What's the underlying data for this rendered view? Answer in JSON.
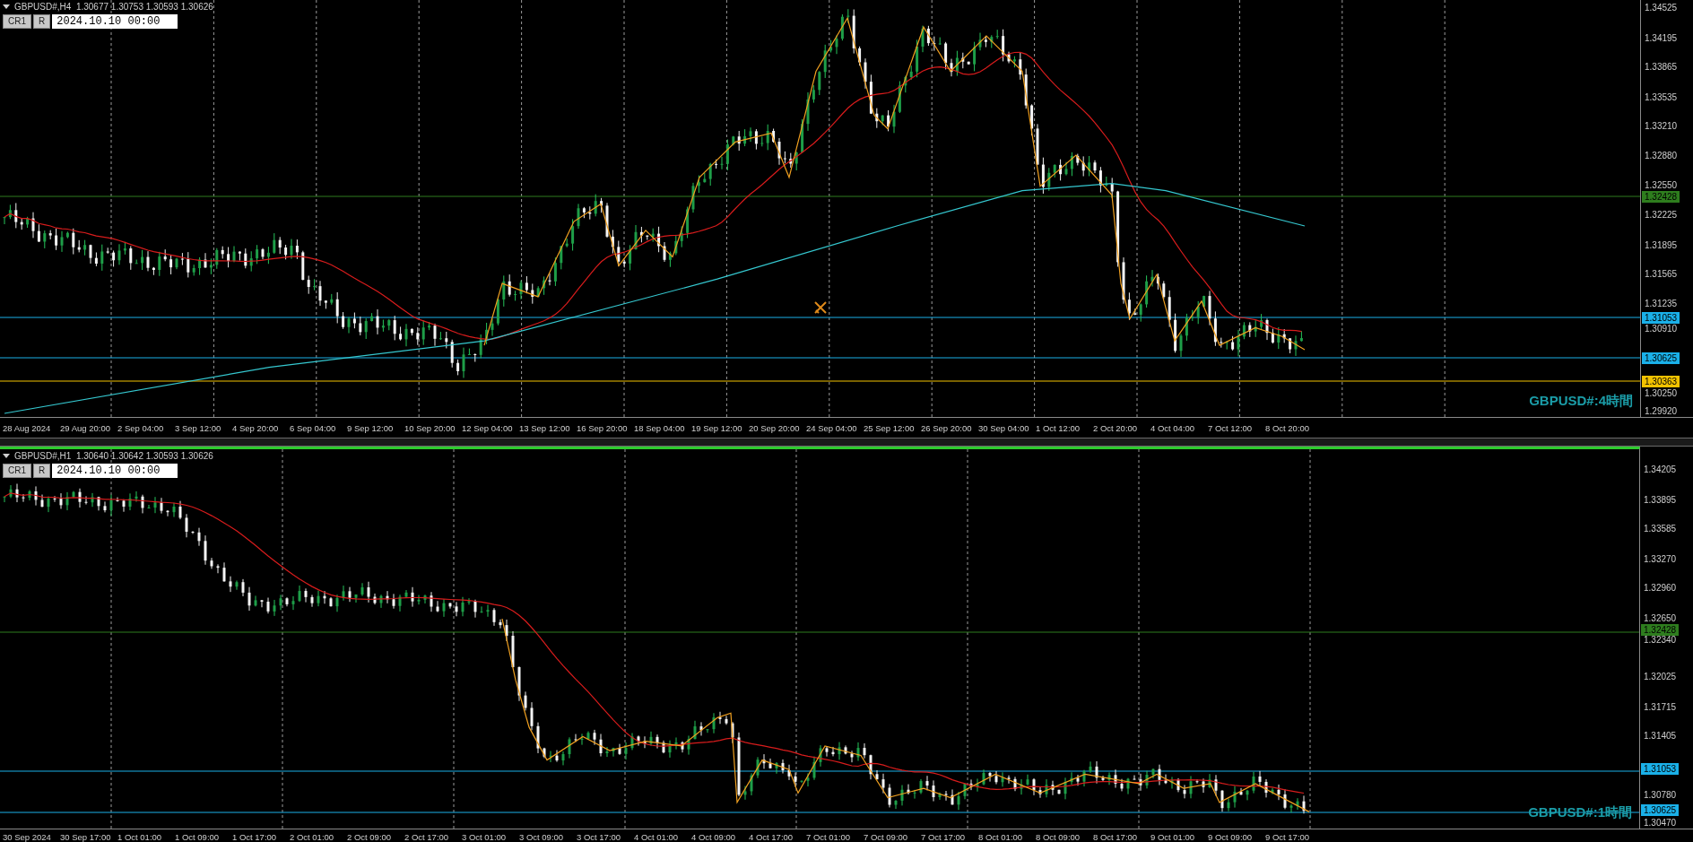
{
  "charts": [
    {
      "header": {
        "title": "GBPUSD#,H4  1.30677 1.30753 1.30593 1.30626"
      },
      "buttons": [
        "CR1",
        "R"
      ],
      "date_field": "2024.10.10 00:00",
      "price_ticks": [
        "1.34525",
        "1.34195",
        "1.33865",
        "1.33535",
        "1.33210",
        "1.32880",
        "1.32550",
        "1.32225",
        "1.31895",
        "1.31565",
        "1.31235",
        "1.30910",
        "1.30250",
        "1.29920"
      ],
      "levels": [
        {
          "price": "1.32428",
          "color": "#2e7d1e"
        },
        {
          "price": "1.31053",
          "color": "#1ab0e8"
        },
        {
          "price": "1.30625",
          "color": "#1ab0e8"
        },
        {
          "price": "1.30363",
          "color": "#f2c200"
        }
      ],
      "time_labels": [
        "28 Aug 2024",
        "29 Aug 20:00",
        "2 Sep 04:00",
        "3 Sep 12:00",
        "4 Sep 20:00",
        "6 Sep 04:00",
        "9 Sep 12:00",
        "10 Sep 20:00",
        "12 Sep 04:00",
        "13 Sep 12:00",
        "16 Sep 20:00",
        "18 Sep 04:00",
        "19 Sep 12:00",
        "20 Sep 20:00",
        "24 Sep 04:00",
        "25 Sep 12:00",
        "26 Sep 20:00",
        "30 Sep 04:00",
        "1 Oct 12:00",
        "2 Oct 20:00",
        "4 Oct 04:00",
        "7 Oct 12:00",
        "8 Oct 20:00"
      ],
      "timeframe_label": "GBPUSD#:4時間"
    },
    {
      "header": {
        "title": "GBPUSD#,H1  1.30640 1.30642 1.30593 1.30626"
      },
      "buttons": [
        "CR1",
        "R"
      ],
      "date_field": "2024.10.10 00:00",
      "price_ticks": [
        "1.34205",
        "1.33895",
        "1.33585",
        "1.33270",
        "1.32960",
        "1.32650",
        "1.32340",
        "1.32025",
        "1.31715",
        "1.31405",
        "1.30780",
        "1.30470"
      ],
      "levels": [
        {
          "price": "1.32428",
          "color": "#2e7d1e"
        },
        {
          "price": "1.31053",
          "color": "#1ab0e8"
        },
        {
          "price": "1.30625",
          "color": "#1ab0e8"
        }
      ],
      "time_labels": [
        "30 Sep 2024",
        "30 Sep 17:00",
        "1 Oct 01:00",
        "1 Oct 09:00",
        "1 Oct 17:00",
        "2 Oct 01:00",
        "2 Oct 09:00",
        "2 Oct 17:00",
        "3 Oct 01:00",
        "3 Oct 09:00",
        "3 Oct 17:00",
        "4 Oct 01:00",
        "4 Oct 09:00",
        "4 Oct 17:00",
        "7 Oct 01:00",
        "7 Oct 09:00",
        "7 Oct 17:00",
        "8 Oct 01:00",
        "8 Oct 09:00",
        "8 Oct 17:00",
        "9 Oct 01:00",
        "9 Oct 09:00",
        "9 Oct 17:00"
      ],
      "timeframe_label": "GBPUSD#:1時間"
    }
  ]
}
